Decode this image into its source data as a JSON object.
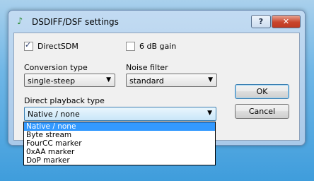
{
  "window": {
    "title": "DSDIFF/DSF settings",
    "help_label": "?",
    "close_label": "✕"
  },
  "options": {
    "direct_sdm": {
      "label": "DirectSDM",
      "checked": true
    },
    "gain_6db": {
      "label": "6 dB gain",
      "checked": false
    }
  },
  "conversion_type": {
    "label": "Conversion type",
    "value": "single-steep"
  },
  "noise_filter": {
    "label": "Noise filter",
    "value": "standard"
  },
  "direct_playback_type": {
    "label": "Direct playback type",
    "value": "Native / none",
    "options": [
      "Native / none",
      "Byte stream",
      "FourCC marker",
      "0xAA marker",
      "DoP marker"
    ],
    "selected_index": 0
  },
  "buttons": {
    "ok": "OK",
    "cancel": "Cancel"
  },
  "colors": {
    "highlight": "#3399ff",
    "accent": "#3c7fb1"
  }
}
